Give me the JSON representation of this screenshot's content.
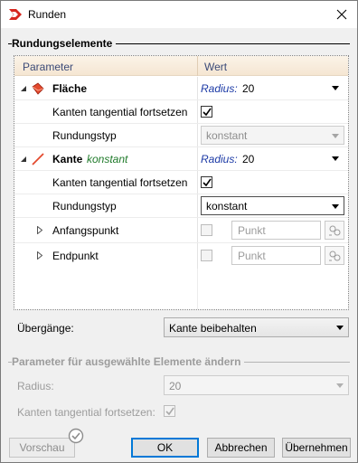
{
  "window": {
    "title": "Runden",
    "icon": "app-logo-icon",
    "close_icon": "close-icon"
  },
  "elements_group": {
    "title": "Rundungselemente",
    "grid": {
      "col_parameter": "Parameter",
      "col_wert": "Wert",
      "rows": {
        "flaeche": {
          "label": "Fläche",
          "radius_label": "Radius:",
          "radius_value": "20"
        },
        "flaeche_tangential": {
          "label": "Kanten tangential fortsetzen",
          "checked": true
        },
        "flaeche_typ": {
          "label": "Rundungstyp",
          "value": "konstant"
        },
        "kante": {
          "label": "Kante",
          "suffix": "konstant",
          "radius_label": "Radius:",
          "radius_value": "20"
        },
        "kante_tangential": {
          "label": "Kanten tangential fortsetzen",
          "checked": true
        },
        "kante_typ": {
          "label": "Rundungstyp",
          "value": "konstant"
        },
        "anfangspunkt": {
          "label": "Anfangspunkt",
          "placeholder": "Punkt",
          "checked": false
        },
        "endpunkt": {
          "label": "Endpunkt",
          "placeholder": "Punkt",
          "checked": false
        }
      }
    }
  },
  "transitions": {
    "label": "Übergänge:",
    "value": "Kante beibehalten"
  },
  "selected_group": {
    "title": "Parameter für ausgewählte Elemente ändern",
    "radius_label": "Radius:",
    "radius_value": "20",
    "tangential_label": "Kanten tangential fortsetzen:",
    "tangential_checked": true
  },
  "buttons": {
    "preview": "Vorschau",
    "ok": "OK",
    "cancel": "Abbrechen",
    "apply": "Übernehmen"
  },
  "colors": {
    "accent": "#0078d7",
    "face_icon": "#e34a2e",
    "label_green": "#1f7a2a",
    "label_blue": "#1c3aa6"
  }
}
